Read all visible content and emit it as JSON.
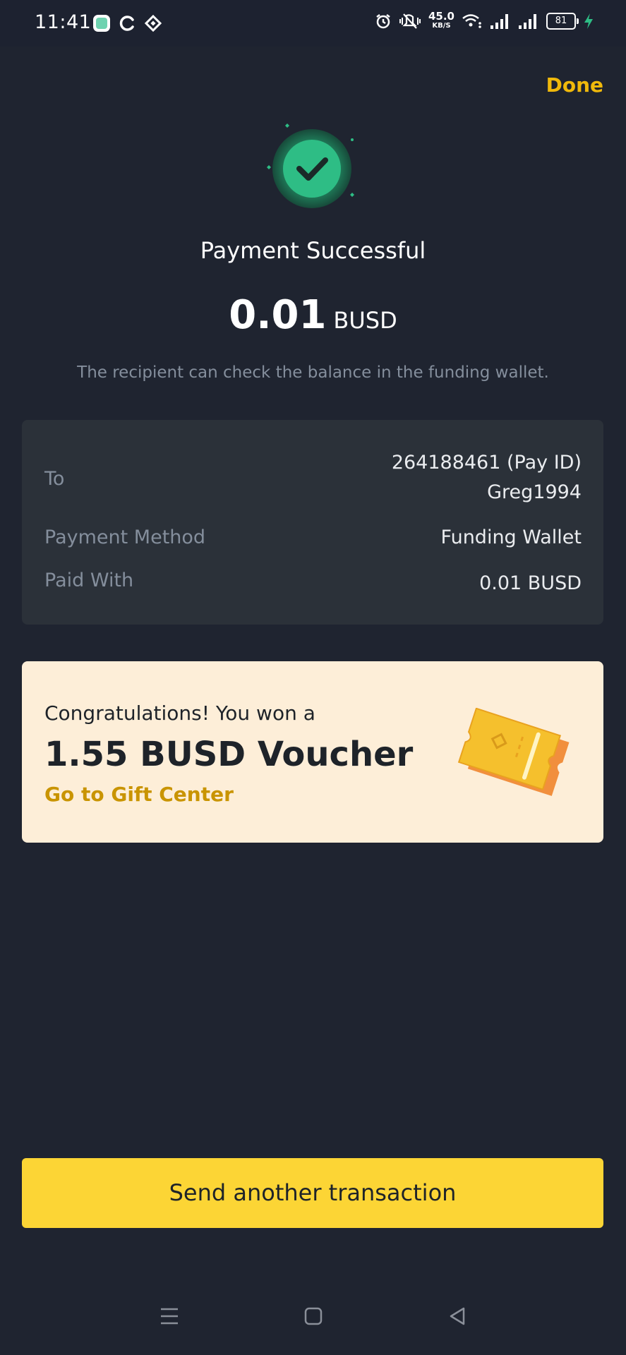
{
  "status_bar": {
    "time": "11:41",
    "speed_value": "45.0",
    "speed_unit": "KB/S",
    "battery": "81",
    "icons_left": [
      "app-icon",
      "c-icon",
      "binance-icon"
    ],
    "icons_right": [
      "alarm-icon",
      "mute-icon",
      "wifi-icon",
      "signal-icon",
      "signal-icon",
      "battery-icon",
      "charging-icon"
    ]
  },
  "header": {
    "done_label": "Done"
  },
  "result": {
    "title": "Payment Successful",
    "amount": "0.01",
    "currency": "BUSD",
    "note": "The recipient can check the balance in the funding wallet."
  },
  "details": {
    "to_label": "To",
    "to_value_id": "264188461 (Pay ID)",
    "to_value_name": "Greg1994",
    "method_label": "Payment Method",
    "method_value": "Funding Wallet",
    "paid_label": "Paid With",
    "paid_value": "0.01 BUSD"
  },
  "voucher": {
    "line1": "Congratulations! You won a",
    "line2": "1.55 BUSD Voucher",
    "link": "Go to Gift Center"
  },
  "cta": {
    "label": "Send another transaction"
  },
  "colors": {
    "background": "#1f2430",
    "card": "#2b3139",
    "accent": "#f0b90b",
    "button": "#fcd535",
    "success": "#2ebd85",
    "voucher_bg": "#fdeed8"
  }
}
